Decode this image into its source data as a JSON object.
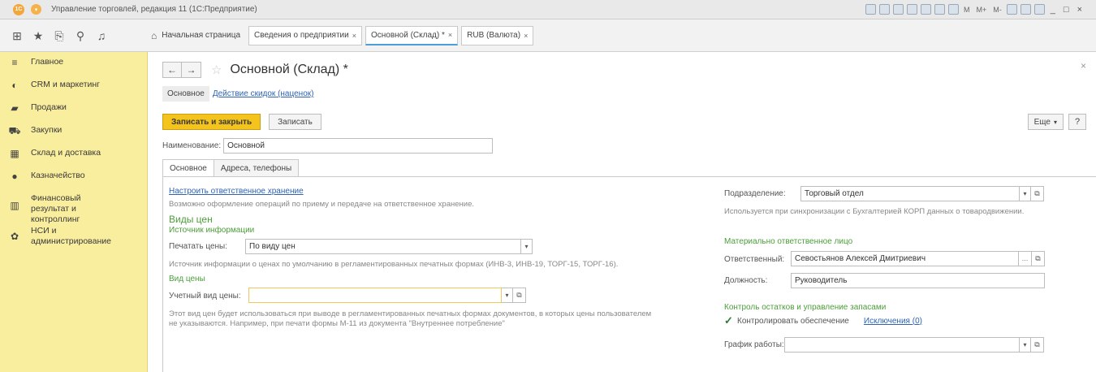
{
  "window": {
    "title": "Управление торговлей, редакция 11 (1С:Предприятие)",
    "controls": [
      "M",
      "M+",
      "M-",
      "_",
      "□",
      "×"
    ]
  },
  "toolbar": {
    "icons": [
      "apps-grid-icon",
      "favorites-star-icon",
      "history-icon",
      "search-icon",
      "notifications-bell-icon"
    ]
  },
  "tabs": {
    "home_label": "Начальная страница",
    "items": [
      {
        "label": "Сведения о предприятии",
        "close": "×",
        "active": false
      },
      {
        "label": "Основной (Склад) *",
        "close": "×",
        "active": true
      },
      {
        "label": "RUB (Валюта)",
        "close": "×",
        "active": false
      }
    ]
  },
  "sidebar": {
    "items": [
      {
        "icon": "menu-lines-icon",
        "glyph": "≡",
        "label": "Главное"
      },
      {
        "icon": "crm-icon",
        "glyph": "◐",
        "label": "CRM и маркетинг"
      },
      {
        "icon": "shopping-bag-icon",
        "glyph": "▰",
        "label": "Продажи"
      },
      {
        "icon": "cart-icon",
        "glyph": "⛟",
        "label": "Закупки"
      },
      {
        "icon": "warehouse-icon",
        "glyph": "▦",
        "label": "Склад и доставка"
      },
      {
        "icon": "coin-icon",
        "glyph": "●",
        "label": "Казначейство"
      },
      {
        "icon": "bar-chart-icon",
        "glyph": "▥",
        "label": "Финансовый результат и контроллинг"
      },
      {
        "icon": "gear-icon",
        "glyph": "✿",
        "label": "НСИ и администрирование"
      }
    ]
  },
  "form": {
    "title": "Основной (Склад) *",
    "close": "×",
    "section_active": "Основное",
    "section_link": "Действие скидок (наценок)",
    "save_close_label": "Записать и закрыть",
    "save_label": "Записать",
    "more_label": "Еще",
    "help_label": "?",
    "name_label": "Наименование:",
    "name_value": "Основной",
    "tabs": [
      "Основное",
      "Адреса, телефоны"
    ]
  },
  "left": {
    "storage_link": "Настроить ответственное хранение",
    "storage_note": "Возможно оформление операций по приему и передаче на ответственное хранение.",
    "price_group_title": "Виды цен",
    "info_source_title": "Источник информации",
    "print_prices_label": "Печатать цены:",
    "print_prices_value": "По виду цен",
    "print_prices_note": "Источник информации о ценах по умолчанию в регламентированных печатных формах (ИНВ-3, ИНВ-19, ТОРГ-15, ТОРГ-16).",
    "price_type_title": "Вид цены",
    "account_price_label": "Учетный вид цены:",
    "account_price_value": "",
    "account_price_note_1": "Этот вид цен будет использоваться при выводе в регламентированных печатных формах документов, в которых цены пользователем",
    "account_price_note_2": "не указываются. Например, при печати формы М-11 из документа \"Внутреннее потребление\""
  },
  "right": {
    "department_label": "Подразделение:",
    "department_value": "Торговый отдел",
    "department_note": "Используется при синхронизации с Бухгалтерией КОРП данных о товародвижении.",
    "responsible_group_title": "Материально ответственное лицо",
    "responsible_label": "Ответственный:",
    "responsible_value": "Севостьянов Алексей Дмитриевич",
    "position_label": "Должность:",
    "position_value": "Руководитель",
    "stock_group_title": "Контроль остатков и управление запасами",
    "control_supply_label": "Контролировать обеспечение",
    "control_supply_checked": true,
    "exceptions_link": "Исключения (0)",
    "schedule_label": "График работы:",
    "schedule_value": ""
  },
  "colors": {
    "sidebar_bg": "#f9ed9e",
    "primary_button": "#f4c31c",
    "link": "#2f62b2",
    "group_title": "#4b9e3a"
  }
}
